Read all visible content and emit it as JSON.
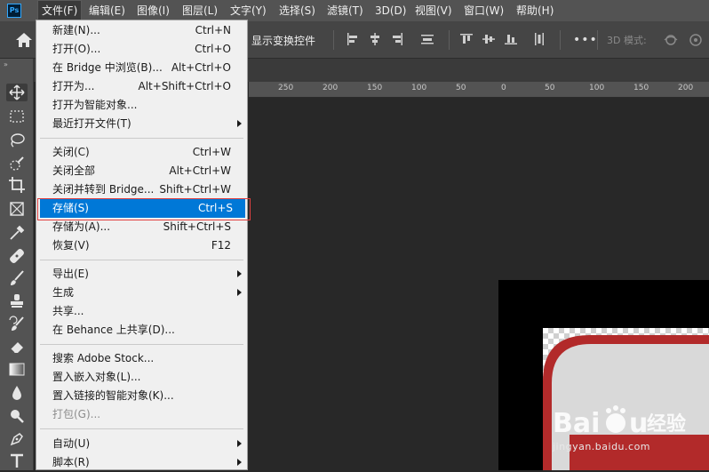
{
  "menubar": {
    "items": [
      "文件(F)",
      "编辑(E)",
      "图像(I)",
      "图层(L)",
      "文字(Y)",
      "选择(S)",
      "滤镜(T)",
      "3D(D)",
      "视图(V)",
      "窗口(W)",
      "帮助(H)"
    ],
    "active_index": 0
  },
  "app_logo": "Ps",
  "options": {
    "transform_label": "显示变换控件",
    "mode_label": "3D 模式:",
    "more": "•••"
  },
  "ruler": {
    "labels": [
      "250",
      "200",
      "150",
      "100",
      "50",
      "0",
      "50",
      "100",
      "150",
      "200"
    ]
  },
  "file_menu": {
    "items": [
      {
        "label": "新建(N)...",
        "shortcut": "Ctrl+N"
      },
      {
        "label": "打开(O)...",
        "shortcut": "Ctrl+O"
      },
      {
        "label": "在 Bridge 中浏览(B)...",
        "shortcut": "Alt+Ctrl+O"
      },
      {
        "label": "打开为...",
        "shortcut": "Alt+Shift+Ctrl+O"
      },
      {
        "label": "打开为智能对象...",
        "shortcut": ""
      },
      {
        "label": "最近打开文件(T)",
        "shortcut": "",
        "submenu": true
      },
      {
        "label": "关闭(C)",
        "shortcut": "Ctrl+W"
      },
      {
        "label": "关闭全部",
        "shortcut": "Alt+Ctrl+W"
      },
      {
        "label": "关闭并转到 Bridge...",
        "shortcut": "Shift+Ctrl+W"
      },
      {
        "label": "存储(S)",
        "shortcut": "Ctrl+S",
        "highlight": true
      },
      {
        "label": "存储为(A)...",
        "shortcut": "Shift+Ctrl+S"
      },
      {
        "label": "恢复(V)",
        "shortcut": "F12"
      },
      {
        "label": "导出(E)",
        "shortcut": "",
        "submenu": true
      },
      {
        "label": "生成",
        "shortcut": "",
        "submenu": true
      },
      {
        "label": "共享...",
        "shortcut": ""
      },
      {
        "label": "在 Behance 上共享(D)...",
        "shortcut": ""
      },
      {
        "label": "搜索 Adobe Stock...",
        "shortcut": ""
      },
      {
        "label": "置入嵌入对象(L)...",
        "shortcut": ""
      },
      {
        "label": "置入链接的智能对象(K)...",
        "shortcut": ""
      },
      {
        "label": "打包(G)...",
        "shortcut": "",
        "disabled": true
      },
      {
        "label": "自动(U)",
        "shortcut": "",
        "submenu": true
      },
      {
        "label": "脚本(R)",
        "shortcut": "",
        "submenu": true
      }
    ]
  },
  "watermark": {
    "url": "jingyan.baidu.com"
  },
  "colors": {
    "menu_highlight": "#0078d7",
    "annotation_box": "#e04040",
    "artwork_red": "#b22a2a"
  }
}
